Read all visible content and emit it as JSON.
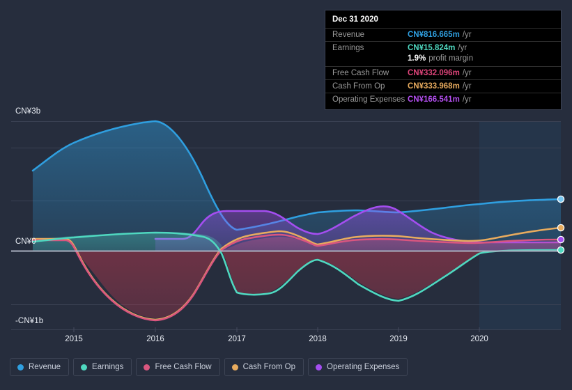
{
  "tooltip": {
    "date": "Dec 31 2020",
    "rows": [
      {
        "label": "Revenue",
        "value": "CN¥816.665m",
        "unit": "/yr",
        "color": "#2f9fe0"
      },
      {
        "label": "Earnings",
        "value": "CN¥15.824m",
        "unit": "/yr",
        "color": "#4fd8c0"
      },
      {
        "label": "Free Cash Flow",
        "value": "CN¥332.096m",
        "unit": "/yr",
        "color": "#e0457b"
      },
      {
        "label": "Cash From Op",
        "value": "CN¥333.968m",
        "unit": "/yr",
        "color": "#e8ab5e"
      },
      {
        "label": "Operating Expenses",
        "value": "CN¥166.541m",
        "unit": "/yr",
        "color": "#b44ff0"
      }
    ],
    "margin_value": "1.9%",
    "margin_label": "profit margin"
  },
  "axes": {
    "y_top": "CN¥3b",
    "y_zero": "CN¥0",
    "y_bottom": "-CN¥1b",
    "x_ticks": [
      "2015",
      "2016",
      "2017",
      "2018",
      "2019",
      "2020"
    ]
  },
  "legend": [
    {
      "label": "Revenue",
      "color": "#2f9fe0"
    },
    {
      "label": "Earnings",
      "color": "#4fd8c0"
    },
    {
      "label": "Free Cash Flow",
      "color": "#d9567f"
    },
    {
      "label": "Cash From Op",
      "color": "#e8ab5e"
    },
    {
      "label": "Operating Expenses",
      "color": "#a44ef0"
    }
  ],
  "chart_data": {
    "type": "area",
    "title": "",
    "xlabel": "",
    "ylabel": "CN¥",
    "ylim": [
      -1.0,
      3.0
    ],
    "y_ticks": [
      3.0,
      2.5,
      1.5,
      0.0,
      -1.0
    ],
    "y_tick_labels": [
      "CN¥3b",
      "",
      "",
      "CN¥0",
      "-CN¥1b"
    ],
    "grid": true,
    "legend_position": "bottom",
    "units": "CN¥ billions",
    "x_tick_years": [
      2015,
      2016,
      2017,
      2018,
      2019,
      2020
    ],
    "forecast_start": "2020.2",
    "series": [
      {
        "name": "Revenue",
        "color": "#2f9fe0",
        "x": [
          2014.55,
          2015.0,
          2015.5,
          2016.0,
          2016.25,
          2016.5,
          2017.0,
          2017.5,
          2018.0,
          2018.5,
          2019.0,
          2019.5,
          2020.0,
          2020.5,
          2021.0
        ],
        "values": [
          1.88,
          2.35,
          2.68,
          2.92,
          2.9,
          2.2,
          1.1,
          1.35,
          1.55,
          1.58,
          1.5,
          1.52,
          1.68,
          1.78,
          1.8
        ]
      },
      {
        "name": "Earnings",
        "color": "#4fd8c0",
        "x": [
          2014.55,
          2015.0,
          2015.5,
          2016.0,
          2016.5,
          2017.0,
          2017.5,
          2018.0,
          2018.5,
          2019.0,
          2019.5,
          2020.0,
          2020.5,
          2021.0
        ],
        "values": [
          0.18,
          0.2,
          0.26,
          0.28,
          0.25,
          -0.42,
          -0.42,
          -0.2,
          -0.35,
          -0.62,
          -0.72,
          -0.25,
          0.0,
          0.0
        ]
      },
      {
        "name": "Free Cash Flow",
        "color": "#d9567f",
        "x": [
          2014.55,
          2015.0,
          2015.5,
          2016.0,
          2016.5,
          2017.0,
          2017.5,
          2018.0,
          2018.5,
          2019.0,
          2019.5,
          2020.0,
          2020.5,
          2021.0
        ],
        "values": [
          0.2,
          0.0,
          -0.62,
          -0.92,
          -0.88,
          0.1,
          0.17,
          0.08,
          0.12,
          0.12,
          0.08,
          0.06,
          0.2,
          0.33
        ]
      },
      {
        "name": "Cash From Op",
        "color": "#e8ab5e",
        "x": [
          2014.55,
          2015.0,
          2015.5,
          2016.0,
          2016.5,
          2017.0,
          2017.5,
          2018.0,
          2018.5,
          2019.0,
          2019.5,
          2020.0,
          2020.5,
          2021.0
        ],
        "values": [
          0.22,
          0.0,
          -0.62,
          -0.95,
          -0.9,
          0.12,
          0.2,
          0.1,
          0.14,
          0.12,
          0.09,
          0.08,
          0.22,
          0.34
        ]
      },
      {
        "name": "Operating Expenses",
        "color": "#a44ef0",
        "x": [
          2016.0,
          2016.5,
          2017.0,
          2017.5,
          2018.0,
          2018.5,
          2019.0,
          2019.5,
          2020.0,
          2020.5,
          2021.0
        ],
        "values": [
          0.12,
          0.12,
          0.85,
          0.85,
          0.35,
          0.8,
          1.08,
          0.72,
          0.18,
          0.17,
          0.17
        ]
      }
    ]
  }
}
